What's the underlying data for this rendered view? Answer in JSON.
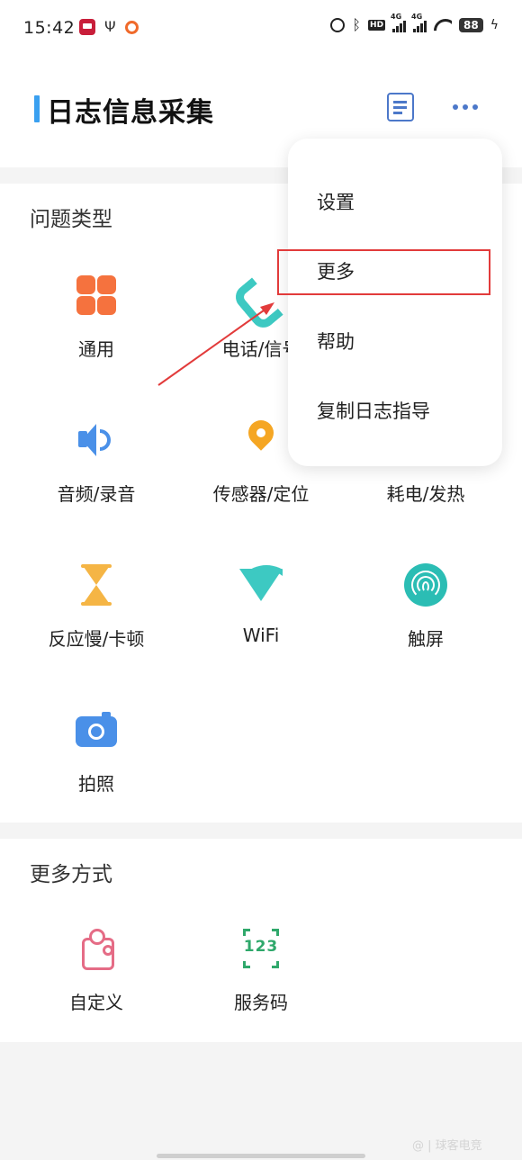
{
  "status_bar": {
    "time": "15:42",
    "network_1": "4G",
    "network_2": "4G",
    "hd_badge": "HD",
    "battery": "88"
  },
  "header": {
    "title": "日志信息采集",
    "doc_icon": "document-list-icon",
    "more_icon": "more-dots-icon",
    "accent_color": "#3aa0f0"
  },
  "problem_types": {
    "section_title": "问题类型",
    "items": [
      {
        "label": "通用",
        "icon": "grid-icon"
      },
      {
        "label": "电话/信号",
        "icon": "phone-icon"
      },
      {
        "label": "音频/录音",
        "icon": "speaker-icon"
      },
      {
        "label": "传感器/定位",
        "icon": "location-pin-icon"
      },
      {
        "label": "耗电/发热",
        "icon": "battery-heat-icon"
      },
      {
        "label": "反应慢/卡顿",
        "icon": "hourglass-icon"
      },
      {
        "label": "WiFi",
        "icon": "wifi-icon"
      },
      {
        "label": "触屏",
        "icon": "fingerprint-icon"
      },
      {
        "label": "拍照",
        "icon": "camera-icon"
      }
    ]
  },
  "more_methods": {
    "section_title": "更多方式",
    "items": [
      {
        "label": "自定义",
        "icon": "puzzle-icon"
      },
      {
        "label": "服务码",
        "icon": "service-code-icon",
        "icon_text": "123"
      }
    ]
  },
  "popup_menu": {
    "items": [
      "设置",
      "更多",
      "帮助",
      "复制日志指导"
    ],
    "highlighted": "更多",
    "highlight_color": "#e23b3b"
  },
  "watermark": "@ | 球客电竞"
}
